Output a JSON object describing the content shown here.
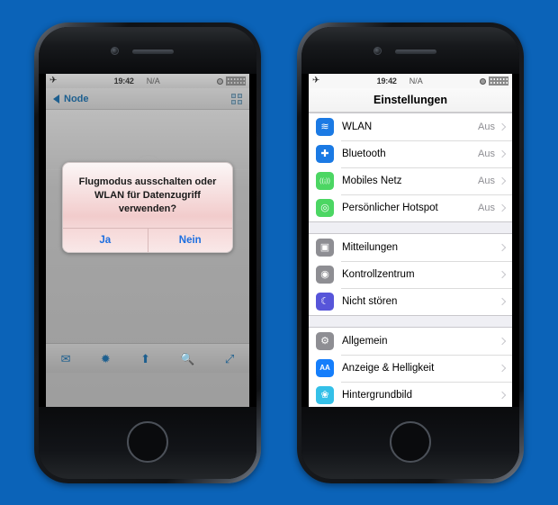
{
  "background_color": "#0b63b8",
  "left_phone": {
    "name": "left-phone",
    "statusbar": {
      "airplane_icon": "airplane-mode-icon",
      "time": "19:42",
      "carrier": "N/A",
      "alarm_icon": "alarm-icon",
      "battery_icon": "battery-icon"
    },
    "navbar": {
      "back_label": "Node",
      "back_icon": "back-arrow-icon",
      "grid_icon": "grid-view-icon"
    },
    "webview": {
      "spinner_icon": "loading-spinner-icon"
    },
    "dialog": {
      "message": "Flugmodus ausschalten oder WLAN für Datenzugriff verwenden?",
      "buttons": [
        {
          "label": "Ja",
          "name": "dialog-confirm-button"
        },
        {
          "label": "Nein",
          "name": "dialog-cancel-button"
        }
      ]
    },
    "toolbar": {
      "items": [
        {
          "name": "mail-icon",
          "glyph": "✉"
        },
        {
          "name": "settings-sun-icon",
          "glyph": "✹"
        },
        {
          "name": "share-upload-icon",
          "glyph": "⬆"
        },
        {
          "name": "search-icon",
          "glyph": "🔍"
        },
        {
          "name": "expand-fullscreen-icon",
          "glyph": "⤢"
        }
      ]
    }
  },
  "right_phone": {
    "name": "right-phone",
    "statusbar": {
      "airplane_icon": "airplane-mode-icon",
      "time": "19:42",
      "carrier": "N/A",
      "alarm_icon": "alarm-icon",
      "battery_icon": "battery-icon"
    },
    "title": "Einstellungen",
    "groups": [
      {
        "rows": [
          {
            "label": "WLAN",
            "value": "Aus",
            "icon": "wifi-icon",
            "icon_class": "ic-wlan",
            "glyph": "≋"
          },
          {
            "label": "Bluetooth",
            "value": "Aus",
            "icon": "bluetooth-icon",
            "icon_class": "ic-bt",
            "glyph": "✚"
          },
          {
            "label": "Mobiles Netz",
            "value": "Aus",
            "icon": "cellular-antenna-icon",
            "icon_class": "ic-cell",
            "glyph": "((¡))"
          },
          {
            "label": "Persönlicher Hotspot",
            "value": "Aus",
            "icon": "personal-hotspot-icon",
            "icon_class": "ic-hotspot",
            "glyph": "◎"
          }
        ]
      },
      {
        "rows": [
          {
            "label": "Mitteilungen",
            "value": "",
            "icon": "notifications-icon",
            "icon_class": "ic-notif",
            "glyph": "▣"
          },
          {
            "label": "Kontrollzentrum",
            "value": "",
            "icon": "control-center-icon",
            "icon_class": "ic-cc",
            "glyph": "◉"
          },
          {
            "label": "Nicht stören",
            "value": "",
            "icon": "do-not-disturb-moon-icon",
            "icon_class": "ic-dnd",
            "glyph": "☾"
          }
        ]
      },
      {
        "rows": [
          {
            "label": "Allgemein",
            "value": "",
            "icon": "general-gear-icon",
            "icon_class": "ic-general",
            "glyph": "⚙"
          },
          {
            "label": "Anzeige & Helligkeit",
            "value": "",
            "icon": "display-brightness-icon",
            "icon_class": "ic-display",
            "glyph": "AA"
          },
          {
            "label": "Hintergrundbild",
            "value": "",
            "icon": "wallpaper-icon",
            "icon_class": "ic-wallpaper",
            "glyph": "❀"
          }
        ]
      }
    ]
  }
}
